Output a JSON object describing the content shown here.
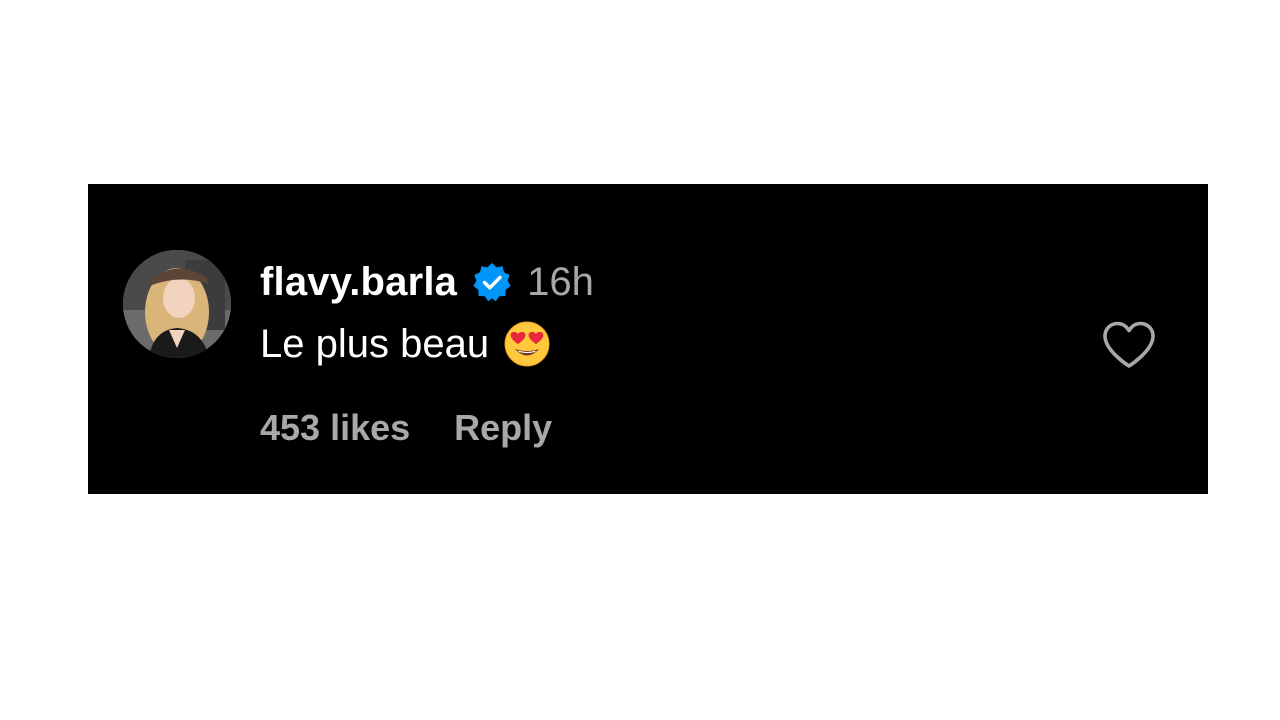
{
  "comment": {
    "username": "flavy.barla",
    "verified": true,
    "timestamp": "16h",
    "text": "Le plus beau",
    "emoji": "smiling-face-with-heart-eyes",
    "likes_label": "453 likes",
    "reply_label": "Reply"
  },
  "colors": {
    "background": "#000000",
    "page": "#ffffff",
    "primary_text": "#ffffff",
    "secondary_text": "#a8a8a8",
    "verified_badge": "#0095f6"
  }
}
